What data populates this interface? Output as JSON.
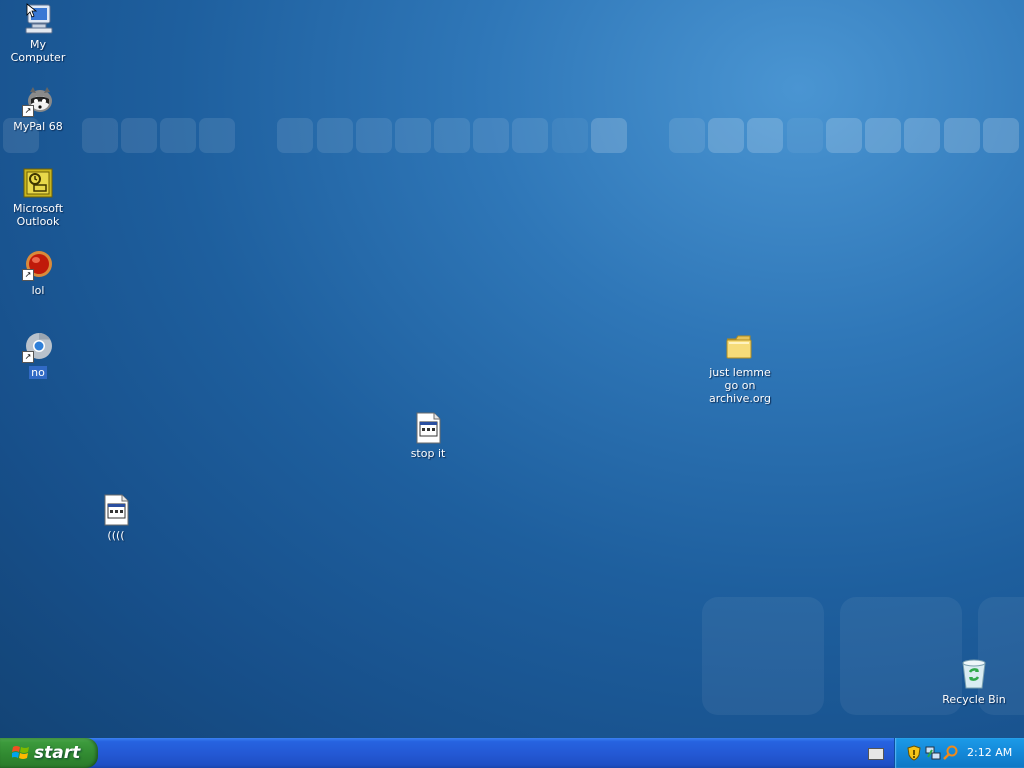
{
  "desktop": {
    "icons": {
      "my_computer": "My Computer",
      "mypal": "MyPal 68",
      "outlook": "Microsoft Outlook",
      "lol": "lol",
      "no": "no",
      "folder": "just lemme go on archive.org",
      "stop_it": "stop it",
      "paren": "((((",
      "recycle_bin": "Recycle Bin"
    }
  },
  "taskbar": {
    "start_label": "start",
    "clock": "2:12 AM"
  },
  "colors": {
    "taskbar_blue": "#2459d5",
    "start_green": "#318a31",
    "tray_blue": "#1488d8",
    "selection": "#316ac5"
  }
}
